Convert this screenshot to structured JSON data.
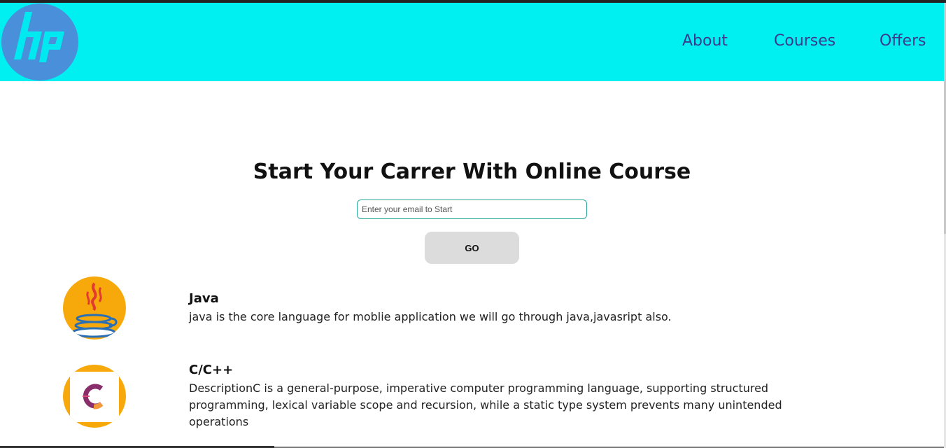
{
  "header": {
    "logo_text": "hp",
    "nav": [
      "About",
      "Courses",
      "Offers"
    ]
  },
  "hero": {
    "title": "Start Your Carrer With Online Course",
    "email_placeholder": "Enter your email to Start",
    "go_label": "GO"
  },
  "courses": [
    {
      "title": "Java",
      "description": "java is the core language for moblie application we will go through java,javasript also.",
      "icon": "java-cup-icon"
    },
    {
      "title": "C/C++",
      "description": "DescriptionC is a general-purpose, imperative computer programming language, supporting structured programming, lexical variable scope and recursion, while a static type system prevents many unintended operations",
      "icon": "c-language-icon"
    }
  ],
  "colors": {
    "header_bg": "#00f0f2",
    "nav_text": "#3a3a8c",
    "logo_bg": "#4a8fd9",
    "course_icon_bg": "#f7a90c",
    "input_border": "#2aa89a",
    "button_bg": "#dcdcdc"
  }
}
